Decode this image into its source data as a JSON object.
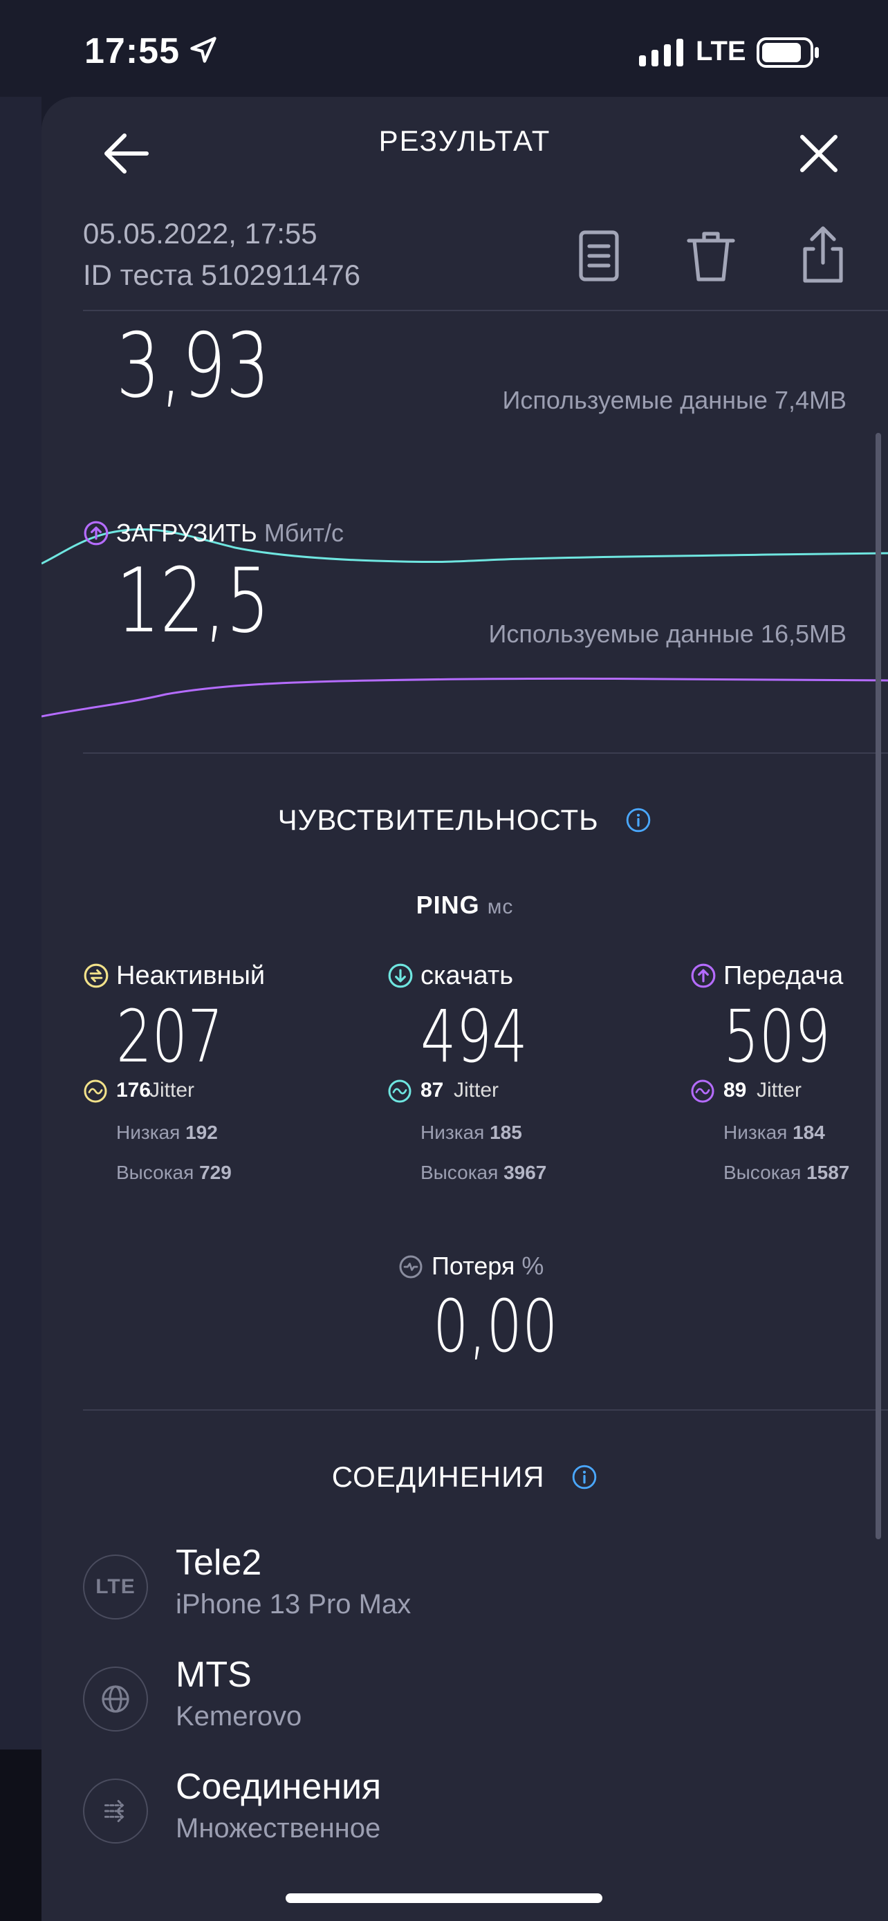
{
  "status_bar": {
    "time": "17:55",
    "network": "LTE"
  },
  "header": {
    "title": "РЕЗУЛЬТАТ"
  },
  "meta": {
    "date": "05.05.2022, 17:55",
    "test_id": "ID теста 5102911476"
  },
  "download": {
    "value": "3,93",
    "used_data": "Используемые данные 7,4MB"
  },
  "upload": {
    "label": "ЗАГРУЗИТЬ",
    "unit": "Мбит/с",
    "value": "12,5",
    "used_data": "Используемые данные 16,5MB"
  },
  "responsiveness": {
    "title": "ЧУВСТВИТЕЛЬНОСТЬ",
    "ping_label": "PING",
    "ping_unit": "мс",
    "columns": [
      {
        "label": "Неактивный",
        "value": "207",
        "jitter_label": "Jitter",
        "jitter": "176",
        "low_label": "Низкая",
        "low": "192",
        "high_label": "Высокая",
        "high": "729"
      },
      {
        "label": "скачать",
        "value": "494",
        "jitter_label": "Jitter",
        "jitter": "87",
        "low_label": "Низкая",
        "low": "185",
        "high_label": "Высокая",
        "high": "3967"
      },
      {
        "label": "Передача",
        "value": "509",
        "jitter_label": "Jitter",
        "jitter": "89",
        "low_label": "Низкая",
        "low": "184",
        "high_label": "Высокая",
        "high": "1587"
      }
    ],
    "loss_label": "Потеря",
    "loss_unit": "%",
    "loss_value": "0,00"
  },
  "connections": {
    "title": "СОЕДИНЕНИЯ",
    "items": [
      {
        "icon": "lte-icon",
        "icon_text": "LTE",
        "title": "Tele2",
        "subtitle": "iPhone 13 Pro Max"
      },
      {
        "icon": "globe-icon",
        "title": "MTS",
        "subtitle": "Kemerovo"
      },
      {
        "icon": "multi-connection-icon",
        "title": "Соединения",
        "subtitle": "Множественное"
      }
    ]
  },
  "colors": {
    "download": "#6fe6e0",
    "upload": "#b56cff",
    "idle": "#f2e28a",
    "info": "#4aa8ff",
    "sheet": "#262838"
  }
}
